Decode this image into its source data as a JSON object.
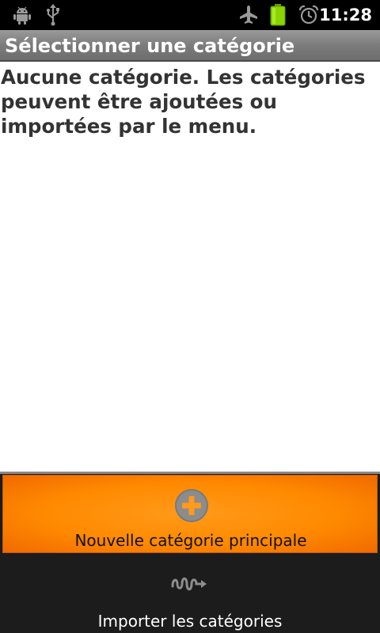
{
  "status_bar": {
    "time": "11:28",
    "icons": [
      "android-debug-icon",
      "usb-icon",
      "airplane-mode-icon",
      "battery-icon",
      "alarm-icon"
    ]
  },
  "title_bar": {
    "title": "Sélectionner une catégorie"
  },
  "main": {
    "empty_message": "Aucune catégorie. Les catégories peuvent être ajoutées ou importées par le menu."
  },
  "menu": {
    "new_category_label": "Nouvelle catégorie principale",
    "new_category_icon": "add-icon",
    "import_label": "Importer les catégories",
    "import_icon": "import-icon"
  },
  "colors": {
    "status_bar_bg": "#000000",
    "title_bar_bg": "#7c7c7c",
    "menu_highlight": "#ff8a00",
    "menu_bg": "#1c1c1c",
    "battery": "#8bd400"
  }
}
